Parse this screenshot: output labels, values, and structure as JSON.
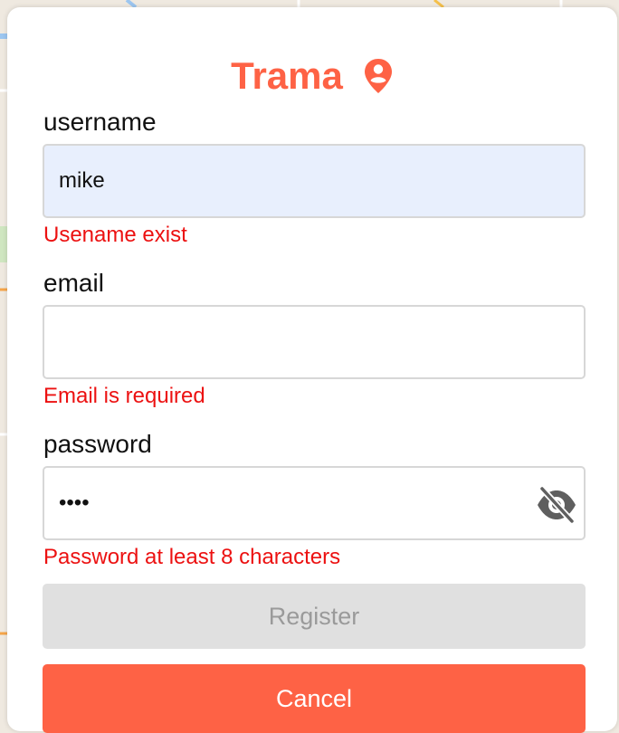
{
  "app": {
    "brand": "Trama",
    "brand_icon": "map-pin-icon",
    "accent_color": "#fe6245",
    "error_color": "#ec1111"
  },
  "form": {
    "username": {
      "label": "username",
      "value": "mike",
      "error": "Usename exist"
    },
    "email": {
      "label": "email",
      "value": "",
      "error": "Email is required"
    },
    "password": {
      "label": "password",
      "value": "1234",
      "error": "Password at least 8 characters",
      "toggle_icon": "eye-off-icon"
    }
  },
  "buttons": {
    "register_label": "Register",
    "register_disabled": true,
    "cancel_label": "Cancel"
  }
}
